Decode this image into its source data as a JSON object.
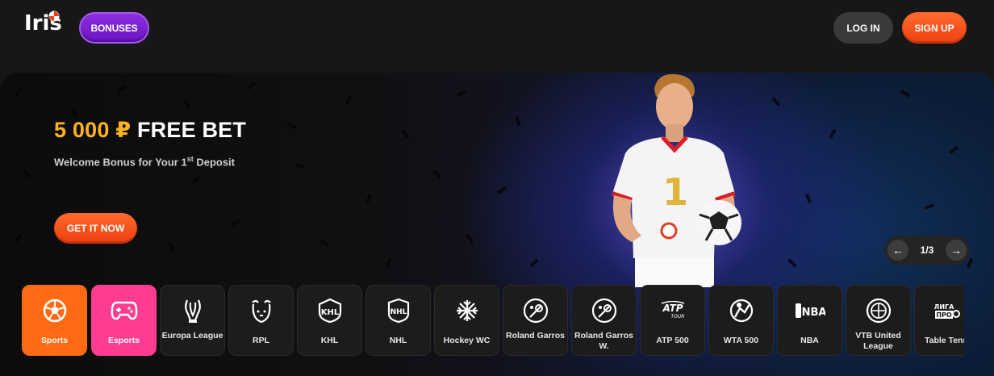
{
  "header": {
    "logo_text": "Iris",
    "bonuses_label": "BONUSES",
    "login_label": "LOG IN",
    "signup_label": "SIGN UP"
  },
  "banner": {
    "headline_amount": "5 000 ₽",
    "headline_rest": "FREE BET",
    "subtitle_pre": "Welcome Bonus for Your 1",
    "subtitle_sup": "st",
    "subtitle_post": " Deposit",
    "cta_label": "GET IT NOW",
    "jersey_number": "1",
    "pager": {
      "prev_icon": "arrow-left-icon",
      "count": "1/3",
      "next_icon": "arrow-right-icon"
    }
  },
  "categories": [
    {
      "label": "Sports",
      "icon": "soccer-ball-icon"
    },
    {
      "label": "Esports",
      "icon": "gamepad-icon"
    },
    {
      "label": "Europa League",
      "icon": "europa-league-icon"
    },
    {
      "label": "RPL",
      "icon": "rpl-icon"
    },
    {
      "label": "KHL",
      "icon": "khl-icon"
    },
    {
      "label": "NHL",
      "icon": "nhl-icon"
    },
    {
      "label": "Hockey WC",
      "icon": "hockey-wc-icon"
    },
    {
      "label": "Roland Garros",
      "icon": "roland-garros-icon"
    },
    {
      "label": "Roland Garros W.",
      "icon": "roland-garros-w-icon"
    },
    {
      "label": "ATP 500",
      "icon": "atp-tour-icon"
    },
    {
      "label": "WTA 500",
      "icon": "wta-icon"
    },
    {
      "label": "NBA",
      "icon": "nba-icon"
    },
    {
      "label": "VTB United League",
      "icon": "vtb-league-icon"
    },
    {
      "label": "Table Tennis",
      "icon": "liga-pro-icon"
    }
  ],
  "colors": {
    "accent_orange": "#ff6a13",
    "accent_pink": "#ff3c8f",
    "bonus_purple": "#7a22d6",
    "headline_gold": "#ffb21f"
  }
}
